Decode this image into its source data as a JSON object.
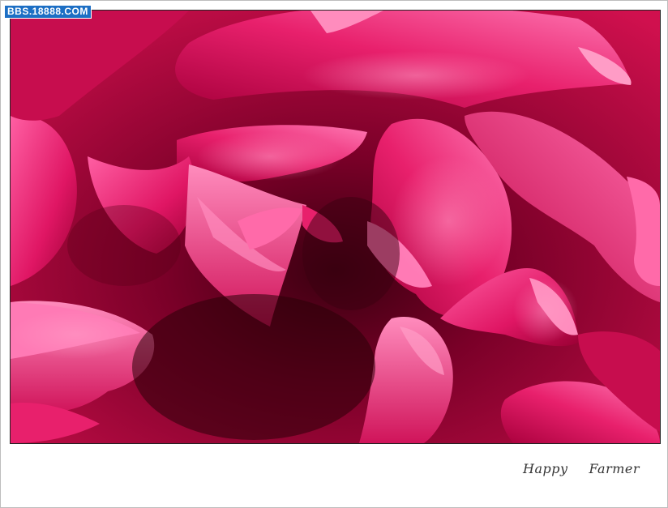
{
  "watermark": {
    "text": "BBS.18888.COM"
  },
  "photo": {
    "subject": "close-up of magenta peony petals",
    "colors": {
      "deep": "#8e0030",
      "mid": "#d4145a",
      "light": "#ff5ca0",
      "highlight": "#ff9cc6"
    }
  },
  "signature": {
    "word1": "Happy",
    "word2": "Farmer"
  }
}
